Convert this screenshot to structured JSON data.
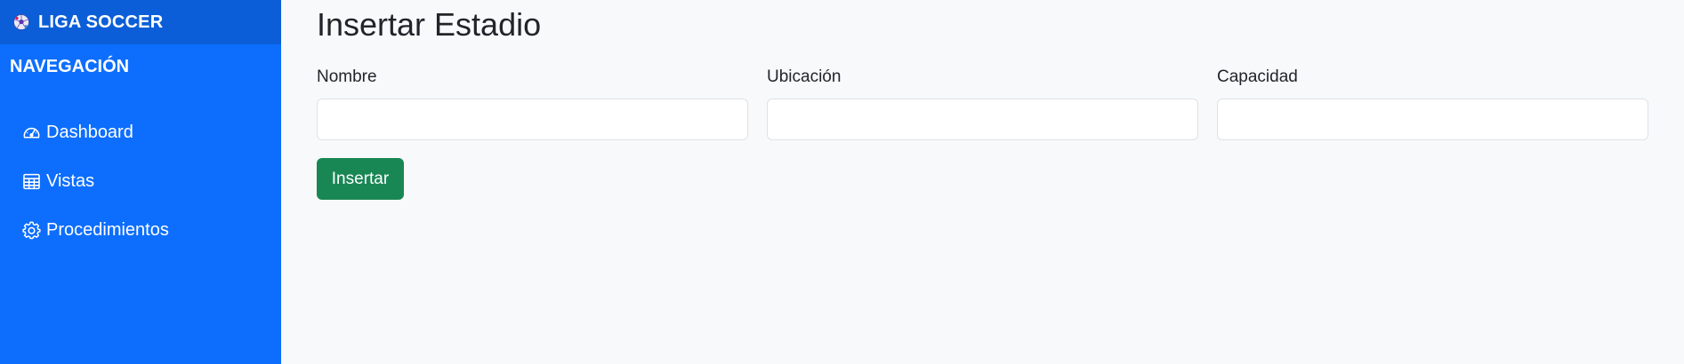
{
  "sidebar": {
    "brand": {
      "title": "LIGA SOCCER",
      "icon": "soccer-ball-icon"
    },
    "heading": "NAVEGACIÓN",
    "items": [
      {
        "label": "Dashboard",
        "icon": "speedometer-icon"
      },
      {
        "label": "Vistas",
        "icon": "table-icon"
      },
      {
        "label": "Procedimientos",
        "icon": "gear-icon"
      }
    ]
  },
  "main": {
    "title": "Insertar Estadio",
    "form": {
      "fields": [
        {
          "label": "Nombre",
          "value": "",
          "placeholder": ""
        },
        {
          "label": "Ubicación",
          "value": "",
          "placeholder": ""
        },
        {
          "label": "Capacidad",
          "value": "",
          "placeholder": ""
        }
      ],
      "submit_label": "Insertar"
    }
  },
  "colors": {
    "sidebar_bg": "#0d6efd",
    "brand_bg": "#0b5ed7",
    "page_bg": "#f8f9fa",
    "submit_bg": "#198754"
  }
}
